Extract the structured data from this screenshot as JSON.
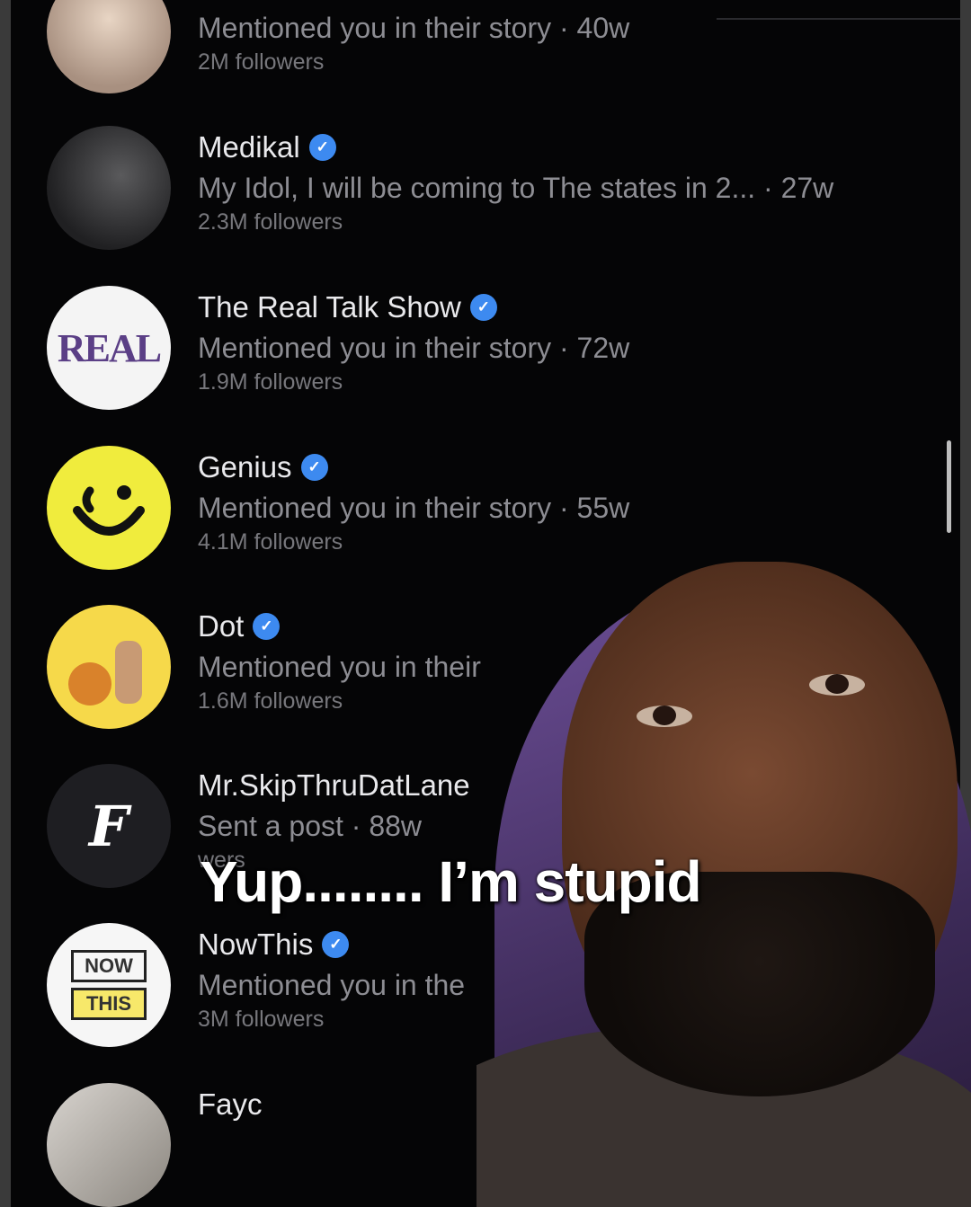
{
  "rows": [
    {
      "name": "",
      "verified": false,
      "sub": "Mentioned you in their story · 40w",
      "followers": "2M followers"
    },
    {
      "name": "Medikal",
      "verified": true,
      "sub": "My Idol, I will be coming to The states in 2...   · 27w",
      "followers": "2.3M followers"
    },
    {
      "name": "The Real Talk Show",
      "verified": true,
      "sub": "Mentioned you in their story · 72w",
      "followers": "1.9M followers",
      "avatar_text": "REAL"
    },
    {
      "name": "Genius",
      "verified": true,
      "sub": "Mentioned you in their story · 55w",
      "followers": "4.1M followers"
    },
    {
      "name": "Dot",
      "verified": true,
      "sub": "Mentioned you in their",
      "followers": "1.6M followers"
    },
    {
      "name": "Mr.SkipThruDatLane",
      "verified": false,
      "sub": "Sent a post · 88w",
      "followers": "wers",
      "avatar_text": "F"
    },
    {
      "name": "NowThis",
      "verified": true,
      "sub": "Mentioned you in the",
      "followers": "3M followers",
      "avatar_text": [
        "NOW",
        "THIS"
      ]
    },
    {
      "name": "Fayc",
      "verified": false,
      "sub": "",
      "followers": ""
    }
  ],
  "caption": "Yup........ I’m stupid",
  "badge_glyph": "✓",
  "colors": {
    "background": "#050506",
    "verified": "#3d8af0",
    "name": "#e9e9ec",
    "sub": "#8d8d93"
  }
}
